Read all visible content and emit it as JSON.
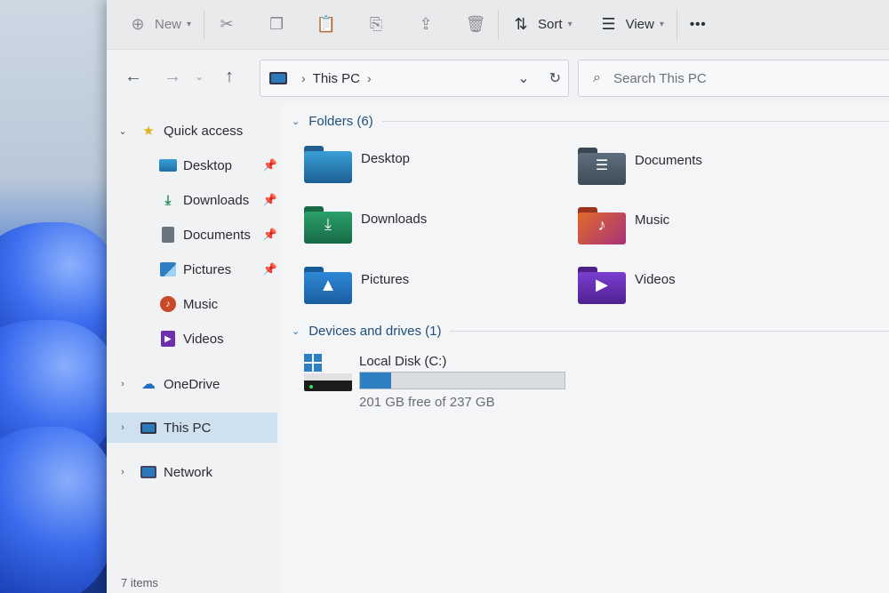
{
  "toolbar": {
    "new_label": "New",
    "sort_label": "Sort",
    "view_label": "View",
    "more_label": "•••"
  },
  "address": {
    "path": "This PC",
    "search_placeholder": "Search This PC"
  },
  "sidebar": {
    "quick_access": "Quick access",
    "items": [
      {
        "label": "Desktop",
        "icon": "desktop-icon",
        "pinned": true
      },
      {
        "label": "Downloads",
        "icon": "download-icon",
        "pinned": true
      },
      {
        "label": "Documents",
        "icon": "documents-icon",
        "pinned": true
      },
      {
        "label": "Pictures",
        "icon": "pictures-icon",
        "pinned": true
      },
      {
        "label": "Music",
        "icon": "music-icon",
        "pinned": false
      },
      {
        "label": "Videos",
        "icon": "videos-icon",
        "pinned": false
      }
    ],
    "onedrive": "OneDrive",
    "this_pc": "This PC",
    "network": "Network"
  },
  "main": {
    "folders_header": "Folders (6)",
    "folders": [
      {
        "label": "Desktop",
        "color": "#1f6fa8"
      },
      {
        "label": "Documents",
        "color": "#4b5b6b"
      },
      {
        "label": "Downloads",
        "color": "#1f8a5a"
      },
      {
        "label": "Music",
        "color": "#c8482a"
      },
      {
        "label": "Pictures",
        "color": "#1f6fc0"
      },
      {
        "label": "Videos",
        "color": "#6b2fb0"
      }
    ],
    "drives_header": "Devices and drives (1)",
    "drive": {
      "name": "Local Disk (C:)",
      "free_text": "201 GB free of 237 GB",
      "used_fraction": 0.152
    }
  },
  "status": {
    "items_count": "7 items"
  },
  "colors": {
    "selected_bg": "#cfe0ee",
    "accent": "#2d7fc1"
  }
}
